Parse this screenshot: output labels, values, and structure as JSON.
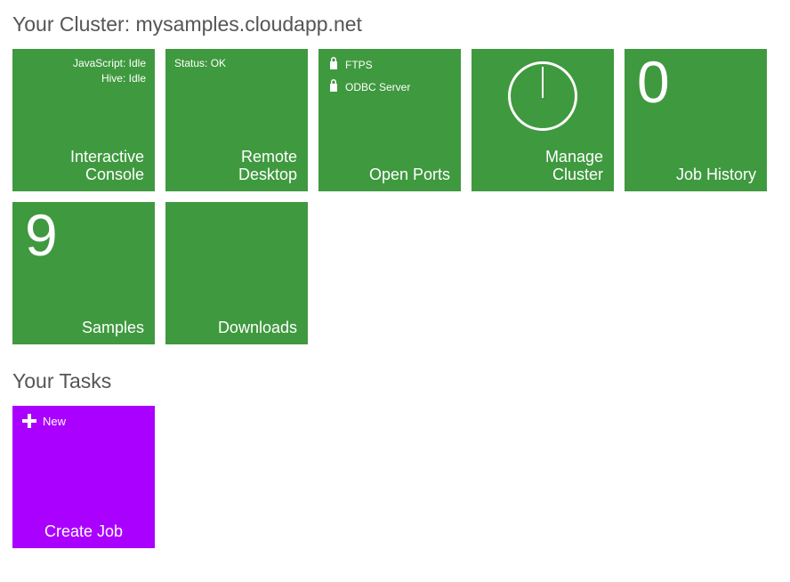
{
  "cluster": {
    "heading_prefix": "Your Cluster: ",
    "name": "mysamples.cloudapp.net"
  },
  "tiles": {
    "interactive_console": {
      "js_status": "JavaScript: Idle",
      "hive_status": "Hive: Idle",
      "title_line1": "Interactive",
      "title_line2": "Console"
    },
    "remote_desktop": {
      "status": "Status: OK",
      "title_line1": "Remote",
      "title_line2": "Desktop"
    },
    "open_ports": {
      "port1": "FTPS",
      "port2": "ODBC Server",
      "title": "Open Ports"
    },
    "manage_cluster": {
      "title_line1": "Manage",
      "title_line2": "Cluster"
    },
    "job_history": {
      "count": "0",
      "title": "Job History"
    },
    "samples": {
      "count": "9",
      "title": "Samples"
    },
    "downloads": {
      "title": "Downloads"
    }
  },
  "tasks": {
    "heading": "Your Tasks",
    "create_job": {
      "new_label": "New",
      "title": "Create Job"
    }
  },
  "colors": {
    "tile_green": "#3f993f",
    "tile_purple": "#aa00ff"
  }
}
